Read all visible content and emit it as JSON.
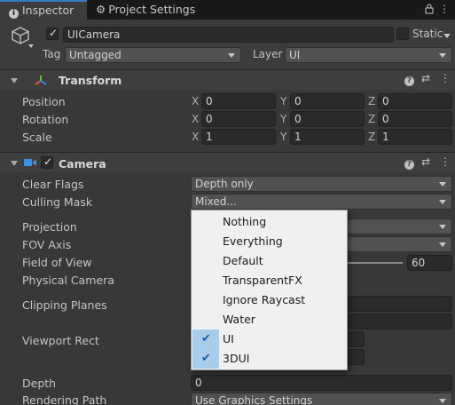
{
  "tabs": {
    "inspector": "Inspector",
    "project_settings": "Project Settings",
    "menu_icon": "kebab-menu-icon",
    "lock_icon": "lock-icon"
  },
  "object": {
    "name": "UICamera",
    "static_label": "Static",
    "tag_label": "Tag",
    "tag_value": "Untagged",
    "layer_label": "Layer",
    "layer_value": "UI"
  },
  "transform": {
    "title": "Transform",
    "rows": [
      {
        "label": "Position",
        "x": "0",
        "y": "0",
        "z": "0"
      },
      {
        "label": "Rotation",
        "x": "0",
        "y": "0",
        "z": "0"
      },
      {
        "label": "Scale",
        "x": "1",
        "y": "1",
        "z": "1"
      }
    ],
    "axis_x": "X",
    "axis_y": "Y",
    "axis_z": "Z"
  },
  "camera": {
    "title": "Camera",
    "clear_flags_label": "Clear Flags",
    "clear_flags_value": "Depth only",
    "culling_mask_label": "Culling Mask",
    "culling_mask_value": "Mixed...",
    "projection_label": "Projection",
    "fov_axis_label": "FOV Axis",
    "fov_label": "Field of View",
    "fov_value": "60",
    "physical_camera_label": "Physical Camera",
    "clipping_planes_label": "Clipping Planes",
    "viewport_rect_label": "Viewport Rect",
    "depth_label": "Depth",
    "depth_value": "0",
    "rendering_path_label": "Rendering Path",
    "rendering_path_value": "Use Graphics Settings"
  },
  "culling_menu": {
    "options": [
      {
        "label": "Nothing",
        "checked": false
      },
      {
        "label": "Everything",
        "checked": false
      },
      {
        "label": "Default",
        "checked": false
      },
      {
        "label": "TransparentFX",
        "checked": false
      },
      {
        "label": "Ignore Raycast",
        "checked": false
      },
      {
        "label": "Water",
        "checked": false
      },
      {
        "label": "UI",
        "checked": true
      },
      {
        "label": "3DUI",
        "checked": true
      }
    ],
    "check_glyph": "✔"
  },
  "colors": {
    "accent": "#3a79bb",
    "panel": "#383838",
    "menu_bg": "#f0f0f0",
    "menu_check_bg": "#a7cdea"
  }
}
